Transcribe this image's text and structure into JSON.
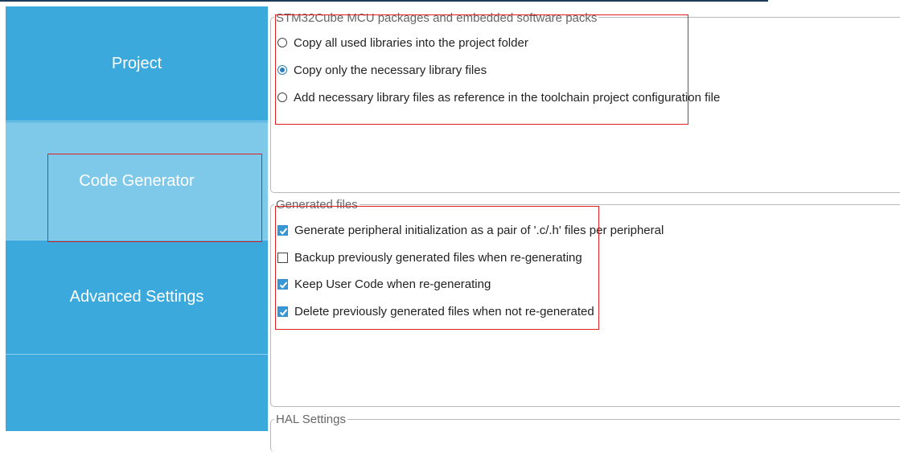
{
  "nav": {
    "items": [
      {
        "label": "Project"
      },
      {
        "label": "Code Generator"
      },
      {
        "label": "Advanced Settings"
      }
    ]
  },
  "packs": {
    "legend": "STM32Cube MCU packages and embedded software packs",
    "options": [
      {
        "label": "Copy all used libraries into the project folder",
        "selected": false
      },
      {
        "label": "Copy only the necessary library files",
        "selected": true
      },
      {
        "label": "Add necessary library files as reference in the toolchain project configuration file",
        "selected": false
      }
    ]
  },
  "generated": {
    "legend": "Generated files",
    "options": [
      {
        "label": "Generate peripheral initialization as a pair of '.c/.h' files per peripheral",
        "checked": true
      },
      {
        "label": "Backup previously generated files when re-generating",
        "checked": false
      },
      {
        "label": "Keep User Code when re-generating",
        "checked": true
      },
      {
        "label": "Delete previously generated files when not re-generated",
        "checked": true
      }
    ]
  },
  "hal": {
    "legend": "HAL Settings"
  },
  "colors": {
    "sidebar": "#3ca9dd",
    "sidebar_active": "#7ec8ea",
    "annotation": "#e02020",
    "accent": "#2a7fc1"
  }
}
